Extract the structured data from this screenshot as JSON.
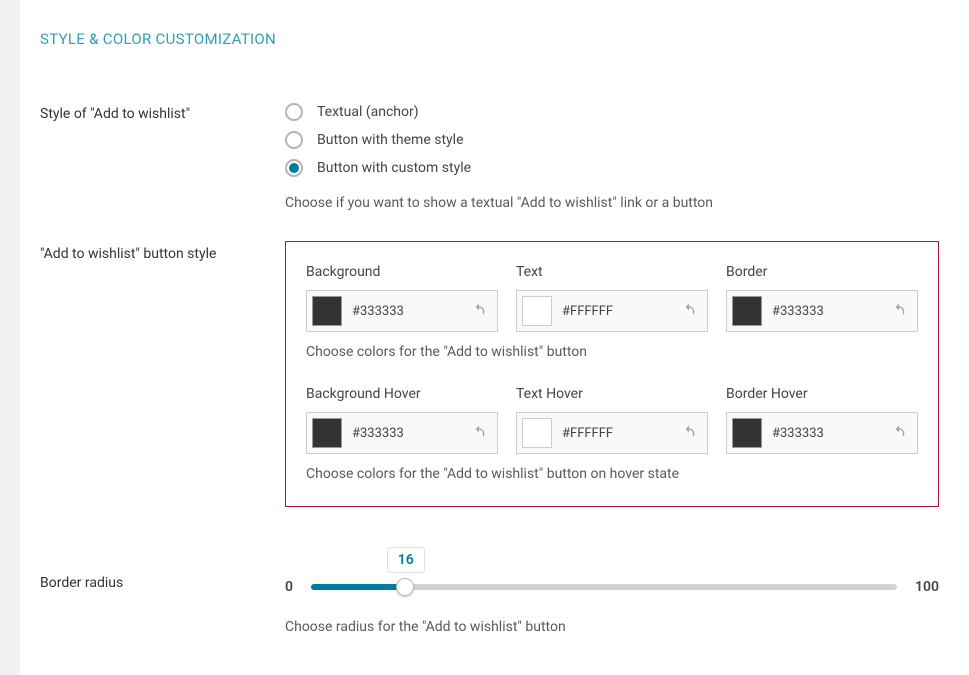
{
  "section_title": "STYLE & COLOR CUSTOMIZATION",
  "style_field": {
    "label": "Style of \"Add to wishlist\"",
    "options": [
      {
        "label": "Textual (anchor)",
        "checked": false
      },
      {
        "label": "Button with theme style",
        "checked": false
      },
      {
        "label": "Button with custom style",
        "checked": true
      }
    ],
    "help": "Choose if you want to show a textual \"Add to wishlist\" link or a button"
  },
  "button_style": {
    "label": "\"Add to wishlist\" button style",
    "row1": [
      {
        "label": "Background",
        "hex": "#333333",
        "swatch": "#333333"
      },
      {
        "label": "Text",
        "hex": "#FFFFFF",
        "swatch": "#ffffff"
      },
      {
        "label": "Border",
        "hex": "#333333",
        "swatch": "#333333"
      }
    ],
    "row1_desc": "Choose colors for the \"Add to wishlist\" button",
    "row2": [
      {
        "label": "Background Hover",
        "hex": "#333333",
        "swatch": "#333333"
      },
      {
        "label": "Text Hover",
        "hex": "#FFFFFF",
        "swatch": "#ffffff"
      },
      {
        "label": "Border Hover",
        "hex": "#333333",
        "swatch": "#333333"
      }
    ],
    "row2_desc": "Choose colors for the \"Add to wishlist\" button on hover state"
  },
  "border_radius": {
    "label": "Border radius",
    "value": "16",
    "min": "0",
    "max": "100",
    "percent": 16,
    "desc": "Choose radius for the \"Add to wishlist\" button"
  }
}
